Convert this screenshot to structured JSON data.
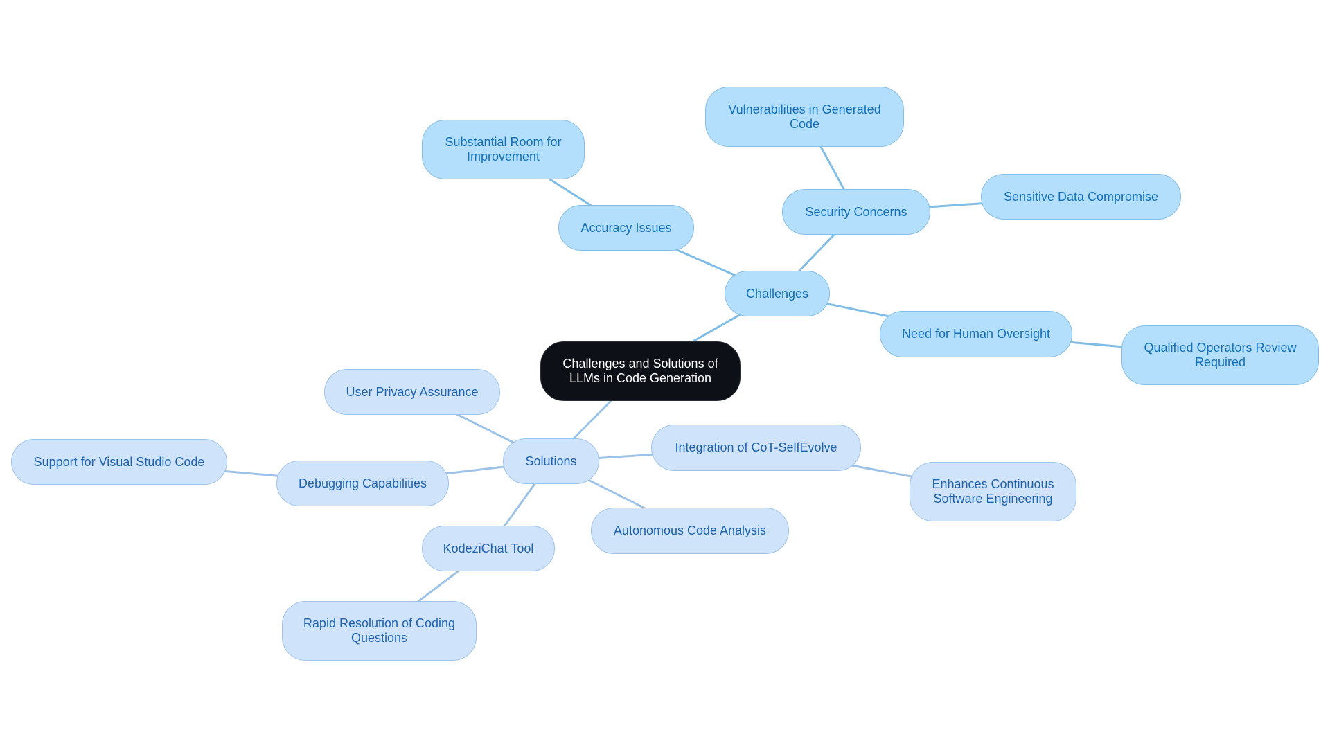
{
  "mindmap": {
    "root": {
      "id": "root",
      "label": "Challenges and Solutions of LLMs in Code Generation"
    },
    "branches": [
      {
        "id": "challenges",
        "label": "Challenges",
        "style": "challenge",
        "children": [
          {
            "id": "accuracy",
            "label": "Accuracy Issues",
            "children": [
              {
                "id": "room",
                "label": "Substantial Room for Improvement"
              }
            ]
          },
          {
            "id": "security",
            "label": "Security Concerns",
            "children": [
              {
                "id": "vuln",
                "label": "Vulnerabilities in Generated Code"
              },
              {
                "id": "sensitive",
                "label": "Sensitive Data Compromise"
              }
            ]
          },
          {
            "id": "oversight",
            "label": "Need for Human Oversight",
            "children": [
              {
                "id": "qualified",
                "label": "Qualified Operators Review Required"
              }
            ]
          }
        ]
      },
      {
        "id": "solutions",
        "label": "Solutions",
        "style": "solution",
        "children": [
          {
            "id": "privacy",
            "label": "User Privacy Assurance",
            "children": []
          },
          {
            "id": "debugging",
            "label": "Debugging Capabilities",
            "children": [
              {
                "id": "vscode",
                "label": "Support for Visual Studio Code"
              }
            ]
          },
          {
            "id": "kodezi",
            "label": "KodeziChat Tool",
            "children": [
              {
                "id": "rapid",
                "label": "Rapid Resolution of Coding Questions"
              }
            ]
          },
          {
            "id": "autonomous",
            "label": "Autonomous Code Analysis",
            "children": []
          },
          {
            "id": "cot",
            "label": "Integration of CoT-SelfEvolve",
            "children": [
              {
                "id": "enhances",
                "label": "Enhances Continuous Software Engineering"
              }
            ]
          }
        ]
      }
    ]
  },
  "colors": {
    "root_bg": "#0d1117",
    "root_text": "#ffffff",
    "challenge_bg": "#b3dffc",
    "challenge_text": "#1370b8",
    "solution_bg": "#cfe4fb",
    "solution_text": "#1f63ad",
    "challenge_edge": "#7fbde6",
    "solution_edge": "#9dc2e8"
  }
}
